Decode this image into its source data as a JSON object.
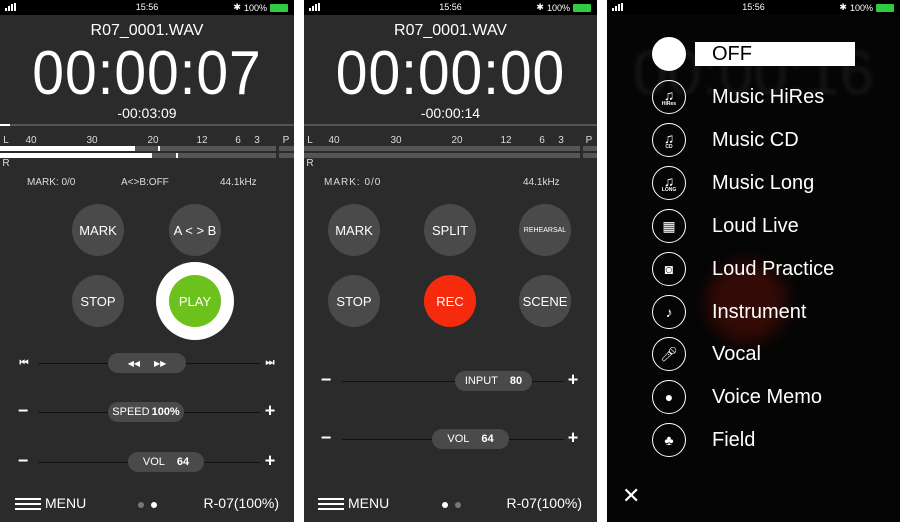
{
  "status": {
    "time": "15:56",
    "battery": "100%",
    "battery_color": "#2ecc40"
  },
  "player": {
    "filename": "R07_0001.WAV",
    "elapsed": "00:00:07",
    "remaining": "-00:03:09",
    "progress_fraction": 0.03,
    "meter": {
      "scale": [
        "L",
        "40",
        "30",
        "20",
        "12",
        "6",
        "3",
        "P"
      ],
      "right_label": "R",
      "level_left_db": -22,
      "level_right_db": -20
    },
    "mark": "MARK: 0/0",
    "ab": "A<>B:OFF",
    "rate": "44.1kHz",
    "buttons": {
      "mark": "MARK",
      "ab": "A < > B",
      "stop": "STOP",
      "play": "PLAY"
    },
    "play_color": "#6cc11d",
    "transport": {
      "rew": "◀◀",
      "ff": "▶▶",
      "prev": "⏮",
      "next": "⏭"
    },
    "speed": {
      "label": "SPEED",
      "value": "100%"
    },
    "vol": {
      "label": "VOL",
      "value": "64"
    },
    "minus": "−",
    "plus": "+",
    "footer": {
      "menu": "MENU",
      "device": "R-07(100%)",
      "page": 2
    }
  },
  "recorder": {
    "filename": "R07_0001.WAV",
    "elapsed": "00:00:00",
    "remaining": "-00:00:14",
    "meter": {
      "scale": [
        "L",
        "40",
        "30",
        "20",
        "12",
        "6",
        "3",
        "P"
      ],
      "right_label": "R"
    },
    "mark": "MARK: 0/0",
    "rate": "44.1kHz",
    "buttons": {
      "mark": "MARK",
      "split": "SPLIT",
      "rehearsal": "REHEARSAL",
      "stop": "STOP",
      "rec": "REC",
      "scene": "SCENE"
    },
    "rec_color": "#f62a0c",
    "input": {
      "label": "INPUT",
      "value": "80"
    },
    "vol": {
      "label": "VOL",
      "value": "64"
    },
    "minus": "−",
    "plus": "+",
    "footer": {
      "menu": "MENU",
      "device": "R-07(100%)",
      "page": 1
    }
  },
  "scene_menu": {
    "background_time": "00:00:16",
    "selected": "OFF",
    "items": [
      {
        "label": "OFF",
        "icon": "off-circle-icon",
        "sub": ""
      },
      {
        "label": "Music HiRes",
        "icon": "music-note-icon",
        "sub": "HiRes"
      },
      {
        "label": "Music CD",
        "icon": "music-note-icon",
        "sub": "CD"
      },
      {
        "label": "Music Long",
        "icon": "music-note-icon",
        "sub": "LONG"
      },
      {
        "label": "Loud Live",
        "icon": "speaker-stack-icon",
        "sub": ""
      },
      {
        "label": "Loud Practice",
        "icon": "speaker-icon",
        "sub": ""
      },
      {
        "label": "Instrument",
        "icon": "guitar-icon",
        "sub": ""
      },
      {
        "label": "Vocal",
        "icon": "microphone-icon",
        "sub": ""
      },
      {
        "label": "Voice Memo",
        "icon": "speech-bubble-icon",
        "sub": ""
      },
      {
        "label": "Field",
        "icon": "tree-icon",
        "sub": ""
      }
    ],
    "close": "✕"
  }
}
